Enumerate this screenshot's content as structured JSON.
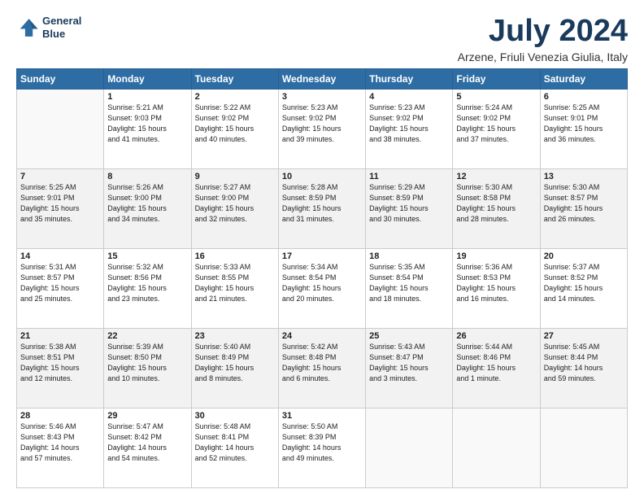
{
  "header": {
    "logo_line1": "General",
    "logo_line2": "Blue",
    "month": "July 2024",
    "location": "Arzene, Friuli Venezia Giulia, Italy"
  },
  "weekdays": [
    "Sunday",
    "Monday",
    "Tuesday",
    "Wednesday",
    "Thursday",
    "Friday",
    "Saturday"
  ],
  "weeks": [
    [
      {
        "day": "",
        "detail": ""
      },
      {
        "day": "1",
        "detail": "Sunrise: 5:21 AM\nSunset: 9:03 PM\nDaylight: 15 hours\nand 41 minutes."
      },
      {
        "day": "2",
        "detail": "Sunrise: 5:22 AM\nSunset: 9:02 PM\nDaylight: 15 hours\nand 40 minutes."
      },
      {
        "day": "3",
        "detail": "Sunrise: 5:23 AM\nSunset: 9:02 PM\nDaylight: 15 hours\nand 39 minutes."
      },
      {
        "day": "4",
        "detail": "Sunrise: 5:23 AM\nSunset: 9:02 PM\nDaylight: 15 hours\nand 38 minutes."
      },
      {
        "day": "5",
        "detail": "Sunrise: 5:24 AM\nSunset: 9:02 PM\nDaylight: 15 hours\nand 37 minutes."
      },
      {
        "day": "6",
        "detail": "Sunrise: 5:25 AM\nSunset: 9:01 PM\nDaylight: 15 hours\nand 36 minutes."
      }
    ],
    [
      {
        "day": "7",
        "detail": "Sunrise: 5:25 AM\nSunset: 9:01 PM\nDaylight: 15 hours\nand 35 minutes."
      },
      {
        "day": "8",
        "detail": "Sunrise: 5:26 AM\nSunset: 9:00 PM\nDaylight: 15 hours\nand 34 minutes."
      },
      {
        "day": "9",
        "detail": "Sunrise: 5:27 AM\nSunset: 9:00 PM\nDaylight: 15 hours\nand 32 minutes."
      },
      {
        "day": "10",
        "detail": "Sunrise: 5:28 AM\nSunset: 8:59 PM\nDaylight: 15 hours\nand 31 minutes."
      },
      {
        "day": "11",
        "detail": "Sunrise: 5:29 AM\nSunset: 8:59 PM\nDaylight: 15 hours\nand 30 minutes."
      },
      {
        "day": "12",
        "detail": "Sunrise: 5:30 AM\nSunset: 8:58 PM\nDaylight: 15 hours\nand 28 minutes."
      },
      {
        "day": "13",
        "detail": "Sunrise: 5:30 AM\nSunset: 8:57 PM\nDaylight: 15 hours\nand 26 minutes."
      }
    ],
    [
      {
        "day": "14",
        "detail": "Sunrise: 5:31 AM\nSunset: 8:57 PM\nDaylight: 15 hours\nand 25 minutes."
      },
      {
        "day": "15",
        "detail": "Sunrise: 5:32 AM\nSunset: 8:56 PM\nDaylight: 15 hours\nand 23 minutes."
      },
      {
        "day": "16",
        "detail": "Sunrise: 5:33 AM\nSunset: 8:55 PM\nDaylight: 15 hours\nand 21 minutes."
      },
      {
        "day": "17",
        "detail": "Sunrise: 5:34 AM\nSunset: 8:54 PM\nDaylight: 15 hours\nand 20 minutes."
      },
      {
        "day": "18",
        "detail": "Sunrise: 5:35 AM\nSunset: 8:54 PM\nDaylight: 15 hours\nand 18 minutes."
      },
      {
        "day": "19",
        "detail": "Sunrise: 5:36 AM\nSunset: 8:53 PM\nDaylight: 15 hours\nand 16 minutes."
      },
      {
        "day": "20",
        "detail": "Sunrise: 5:37 AM\nSunset: 8:52 PM\nDaylight: 15 hours\nand 14 minutes."
      }
    ],
    [
      {
        "day": "21",
        "detail": "Sunrise: 5:38 AM\nSunset: 8:51 PM\nDaylight: 15 hours\nand 12 minutes."
      },
      {
        "day": "22",
        "detail": "Sunrise: 5:39 AM\nSunset: 8:50 PM\nDaylight: 15 hours\nand 10 minutes."
      },
      {
        "day": "23",
        "detail": "Sunrise: 5:40 AM\nSunset: 8:49 PM\nDaylight: 15 hours\nand 8 minutes."
      },
      {
        "day": "24",
        "detail": "Sunrise: 5:42 AM\nSunset: 8:48 PM\nDaylight: 15 hours\nand 6 minutes."
      },
      {
        "day": "25",
        "detail": "Sunrise: 5:43 AM\nSunset: 8:47 PM\nDaylight: 15 hours\nand 3 minutes."
      },
      {
        "day": "26",
        "detail": "Sunrise: 5:44 AM\nSunset: 8:46 PM\nDaylight: 15 hours\nand 1 minute."
      },
      {
        "day": "27",
        "detail": "Sunrise: 5:45 AM\nSunset: 8:44 PM\nDaylight: 14 hours\nand 59 minutes."
      }
    ],
    [
      {
        "day": "28",
        "detail": "Sunrise: 5:46 AM\nSunset: 8:43 PM\nDaylight: 14 hours\nand 57 minutes."
      },
      {
        "day": "29",
        "detail": "Sunrise: 5:47 AM\nSunset: 8:42 PM\nDaylight: 14 hours\nand 54 minutes."
      },
      {
        "day": "30",
        "detail": "Sunrise: 5:48 AM\nSunset: 8:41 PM\nDaylight: 14 hours\nand 52 minutes."
      },
      {
        "day": "31",
        "detail": "Sunrise: 5:50 AM\nSunset: 8:39 PM\nDaylight: 14 hours\nand 49 minutes."
      },
      {
        "day": "",
        "detail": ""
      },
      {
        "day": "",
        "detail": ""
      },
      {
        "day": "",
        "detail": ""
      }
    ]
  ]
}
